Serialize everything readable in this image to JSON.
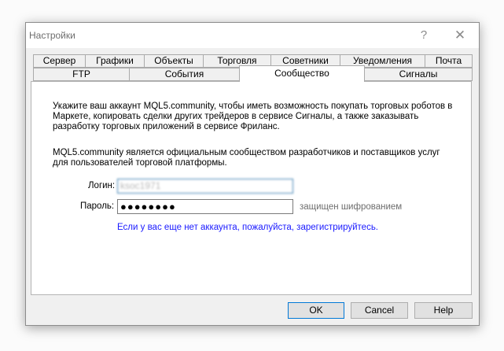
{
  "window": {
    "title": "Настройки",
    "help_glyph": "?",
    "close_glyph": "✕"
  },
  "tabs_row1": [
    "Сервер",
    "Графики",
    "Объекты",
    "Торговля",
    "Советники",
    "Уведомления",
    "Почта"
  ],
  "tabs_row2": [
    "FTP",
    "События",
    "Сообщество",
    "Сигналы"
  ],
  "active_tab": "Сообщество",
  "community": {
    "intro": "Укажите ваш аккаунт MQL5.community, чтобы иметь возможность покупать торговых роботов в Маркете, копировать сделки других трейдеров в сервисе Сигналы, а также заказывать разработку торговых приложений в сервисе Фриланс.",
    "about": "MQL5.community является официальным сообществом разработчиков и поставщиков услуг для пользователей торговой платформы.",
    "login_label": "Логин:",
    "login_value": "ksoc1971",
    "password_label": "Пароль:",
    "password_value": "●●●●●●●●",
    "encryption_note": "защищен шифрованием",
    "register_link": "Если у вас еще нет аккаунта, пожалуйста, зарегистрируйтесь."
  },
  "buttons": {
    "ok": "OK",
    "cancel": "Cancel",
    "help": "Help"
  }
}
